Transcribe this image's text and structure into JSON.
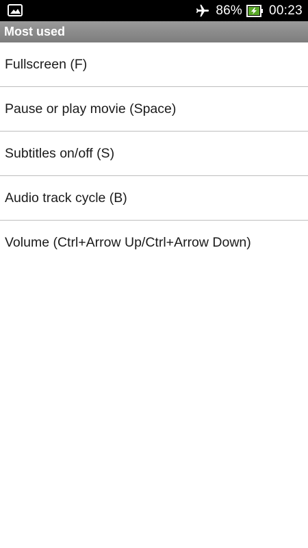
{
  "status_bar": {
    "left_icon": "picture-notification-icon",
    "airplane_icon": "airplane-mode-icon",
    "battery_percent": "86%",
    "battery_icon": "battery-charging-icon",
    "time": "00:23"
  },
  "header": {
    "title": "Most used"
  },
  "items": [
    {
      "label": "Fullscreen (F)"
    },
    {
      "label": "Pause or play movie (Space)"
    },
    {
      "label": "Subtitles on/off (S)"
    },
    {
      "label": "Audio track cycle (B)"
    },
    {
      "label": "Volume (Ctrl+Arrow Up/Ctrl+Arrow Down)"
    }
  ],
  "colors": {
    "status_bar_bg": "#000000",
    "header_bg": "#8a8a8a",
    "battery_charge": "#5aa829"
  }
}
